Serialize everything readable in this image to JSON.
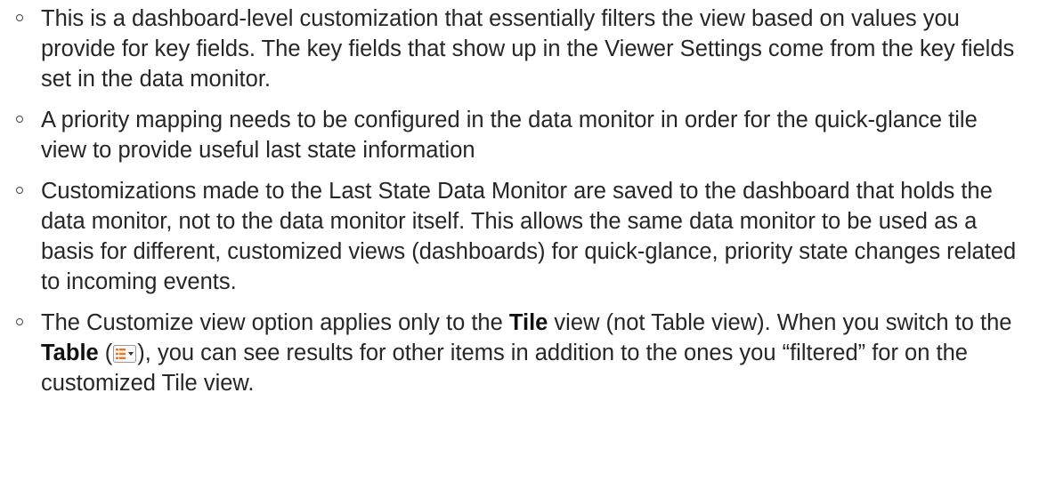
{
  "bullets": [
    {
      "text": "This is a dashboard-level customization that essentially filters the view based on values you provide for key fields. The key fields that show up in the Viewer Settings come from the key fields set in the data monitor."
    },
    {
      "text": "A priority mapping needs to be configured in the data monitor in order for the quick-glance tile view to provide useful last state information"
    },
    {
      "text": "Customizations made to the Last State Data Monitor are saved to the dashboard that holds the data monitor, not to the data monitor itself. This allows the same data monitor to be used as a basis for different, customized views (dashboards) for quick-glance, priority state changes related to incoming events."
    },
    {
      "part1": "The Customize view option applies only to the ",
      "bold1": "Tile",
      "part2": " view (not Table view). When you switch to the ",
      "bold2": "Table",
      "part3": " (",
      "icon": "table-view-dropdown-icon",
      "part4": "), you can see results for other items in addition to the ones you “filtered” for on the customized Tile view."
    }
  ],
  "colors": {
    "text": "#262626",
    "marker": "#444444",
    "icon_accent": "#e8772e"
  }
}
